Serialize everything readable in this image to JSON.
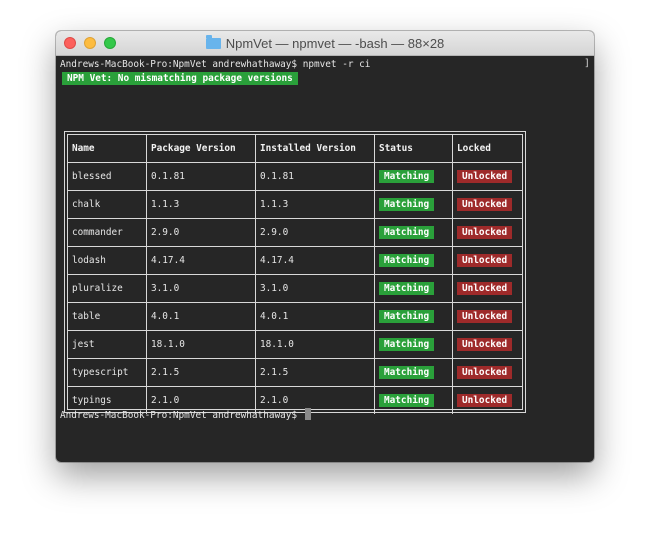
{
  "window": {
    "title": "NpmVet — npmvet — -bash — 88×28",
    "folder_icon": "folder-icon",
    "traffic_lights": [
      "close",
      "minimize",
      "zoom"
    ]
  },
  "terminal": {
    "command_line": "Andrews-MacBook-Pro:NpmVet andrewhathaway$ npmvet -r ci",
    "banner": "NPM Vet: No mismatching package versions",
    "table": {
      "headers": [
        "Name",
        "Package Version",
        "Installed Version",
        "Status",
        "Locked"
      ],
      "rows": [
        {
          "name": "blessed",
          "package": "0.1.81",
          "installed": "0.1.81",
          "status": "Matching",
          "locked": "Unlocked"
        },
        {
          "name": "chalk",
          "package": "1.1.3",
          "installed": "1.1.3",
          "status": "Matching",
          "locked": "Unlocked"
        },
        {
          "name": "commander",
          "package": "2.9.0",
          "installed": "2.9.0",
          "status": "Matching",
          "locked": "Unlocked"
        },
        {
          "name": "lodash",
          "package": "4.17.4",
          "installed": "4.17.4",
          "status": "Matching",
          "locked": "Unlocked"
        },
        {
          "name": "pluralize",
          "package": "3.1.0",
          "installed": "3.1.0",
          "status": "Matching",
          "locked": "Unlocked"
        },
        {
          "name": "table",
          "package": "4.0.1",
          "installed": "4.0.1",
          "status": "Matching",
          "locked": "Unlocked"
        },
        {
          "name": "jest",
          "package": "18.1.0",
          "installed": "18.1.0",
          "status": "Matching",
          "locked": "Unlocked"
        },
        {
          "name": "typescript",
          "package": "2.1.5",
          "installed": "2.1.5",
          "status": "Matching",
          "locked": "Unlocked"
        },
        {
          "name": "typings",
          "package": "2.1.0",
          "installed": "2.1.0",
          "status": "Matching",
          "locked": "Unlocked"
        }
      ]
    },
    "prompt": "Andrews-MacBook-Pro:NpmVet andrewhathaway$",
    "colors": {
      "background": "#262626",
      "matching": "#2aa03a",
      "unlocked": "#9e2a2a",
      "banner": "#2aa03a"
    }
  }
}
